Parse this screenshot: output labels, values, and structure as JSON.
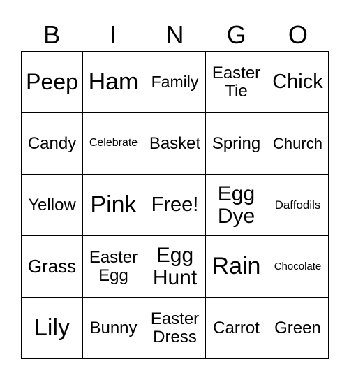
{
  "header": [
    "B",
    "I",
    "N",
    "G",
    "O"
  ],
  "cells": [
    "Peep",
    "Ham",
    "Family",
    "Easter\nTie",
    "Chick",
    "Candy",
    "Celebrate",
    "Basket",
    "Spring",
    "Church",
    "Yellow",
    "Pink",
    "Free!",
    "Egg\nDye",
    "Daffodils",
    "Grass",
    "Easter\nEgg",
    "Egg\nHunt",
    "Rain",
    "Chocolate",
    "Lily",
    "Bunny",
    "Easter\nDress",
    "Carrot",
    "Green"
  ]
}
